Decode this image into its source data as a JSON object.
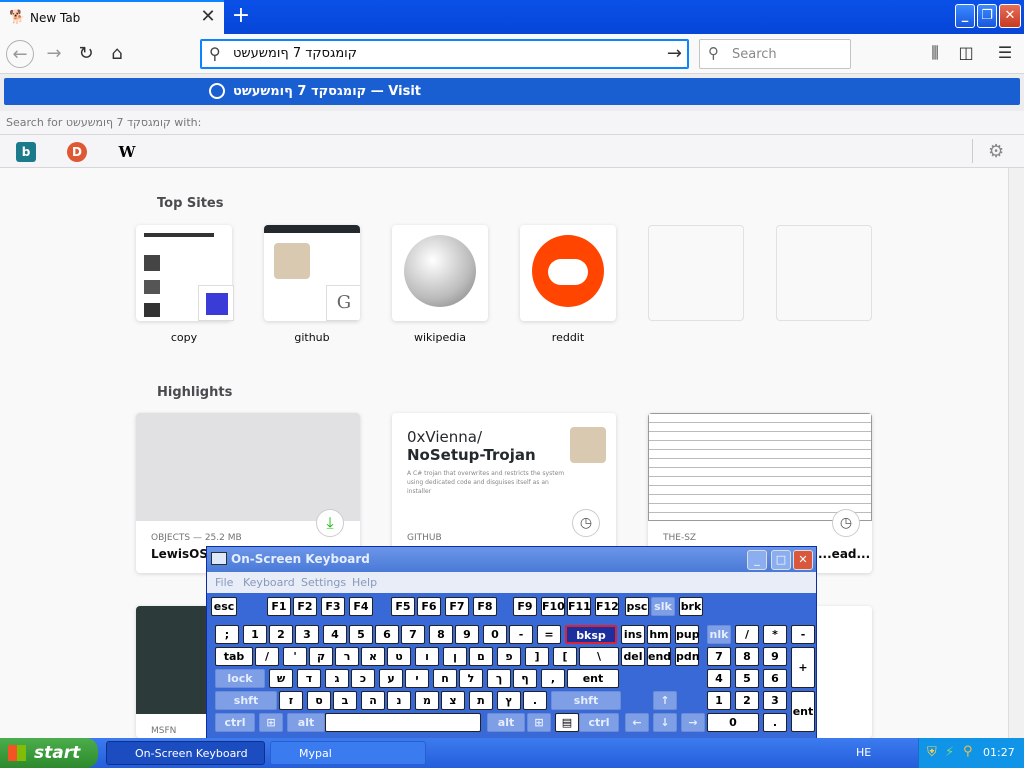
{
  "browser": {
    "tab_title": "New Tab",
    "url_value": "קומגסקד 7 ףומשעשט",
    "search_placeholder": "Search",
    "suggestion_text": "קומגסקד 7 ףומשעשט — Visit",
    "search_for_label": "Search for קומגסקד 7 ףומשעשט with:"
  },
  "newtab": {
    "top_sites_heading": "Top Sites",
    "top_sites": [
      {
        "label": "copy"
      },
      {
        "label": "github"
      },
      {
        "label": "wikipedia"
      },
      {
        "label": "reddit"
      },
      {
        "label": ""
      },
      {
        "label": ""
      }
    ],
    "highlights_heading": "Highlights",
    "highlights": [
      {
        "source": "OBJECTS — 25.2 MB",
        "title": "LewisOS.I..."
      },
      {
        "source": "GITHUB",
        "repo_owner": "0xVienna/",
        "repo_name": "NoSetup-Trojan",
        "desc": "A C# trojan that overwrites and restricts the system using dedicated code and disguises itself as an installer"
      },
      {
        "source": "THE-SZ",
        "title": "...ead..."
      }
    ],
    "row3_source": "MSFN"
  },
  "osk": {
    "title": "On-Screen Keyboard",
    "menu": [
      "File",
      "Keyboard",
      "Settings",
      "Help"
    ],
    "row1": [
      "esc",
      "F1",
      "F2",
      "F3",
      "F4",
      "F5",
      "F6",
      "F7",
      "F8",
      "F9",
      "F10",
      "F11",
      "F12",
      "psc",
      "slk",
      "brk"
    ],
    "row2": [
      ";",
      "1",
      "2",
      "3",
      "4",
      "5",
      "6",
      "7",
      "8",
      "9",
      "0",
      "-",
      "=",
      "bksp",
      "ins",
      "hm",
      "pup",
      "nlk",
      "/",
      "*",
      "-"
    ],
    "row3": [
      "tab",
      "/",
      "'",
      "ק",
      "ר",
      "א",
      "ט",
      "ו",
      "ן",
      "ם",
      "פ",
      "]",
      "[",
      "\\",
      "del",
      "end",
      "pdn",
      "7",
      "8",
      "9",
      "+"
    ],
    "row4": [
      "lock",
      "ש",
      "ד",
      "ג",
      "כ",
      "ע",
      "י",
      "ח",
      "ל",
      "ך",
      "ף",
      ",",
      "ent",
      "4",
      "5",
      "6"
    ],
    "row5": [
      "shft",
      "ז",
      "ס",
      "ב",
      "ה",
      "נ",
      "מ",
      "צ",
      "ת",
      "ץ",
      ".",
      "shft",
      "1",
      "2",
      "3",
      "ent"
    ],
    "row6": [
      "ctrl",
      "alt",
      "alt",
      "ctrl",
      "0",
      "."
    ]
  },
  "taskbar": {
    "start_label": "start",
    "task1": "On-Screen Keyboard",
    "task2": "Mypal",
    "lang": "HE",
    "clock": "01:27"
  }
}
